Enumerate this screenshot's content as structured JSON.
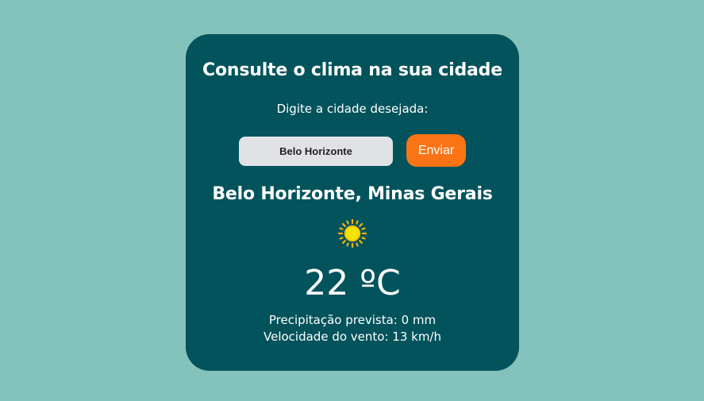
{
  "header": {
    "title": "Consulte o clima na sua cidade",
    "prompt": "Digite a cidade desejada:"
  },
  "search": {
    "value": "Belo Horizonte",
    "button_label": "Enviar"
  },
  "weather": {
    "location": "Belo Horizonte, Minas Gerais",
    "icon": "sun-icon",
    "temperature": "22 ºC",
    "precipitation": "Precipitação prevista: 0 mm",
    "wind": "Velocidade do vento: 13 km/h"
  },
  "colors": {
    "background": "#84c3bb",
    "card": "#02535c",
    "accent": "#fa7416",
    "input": "#e1e2e6"
  }
}
